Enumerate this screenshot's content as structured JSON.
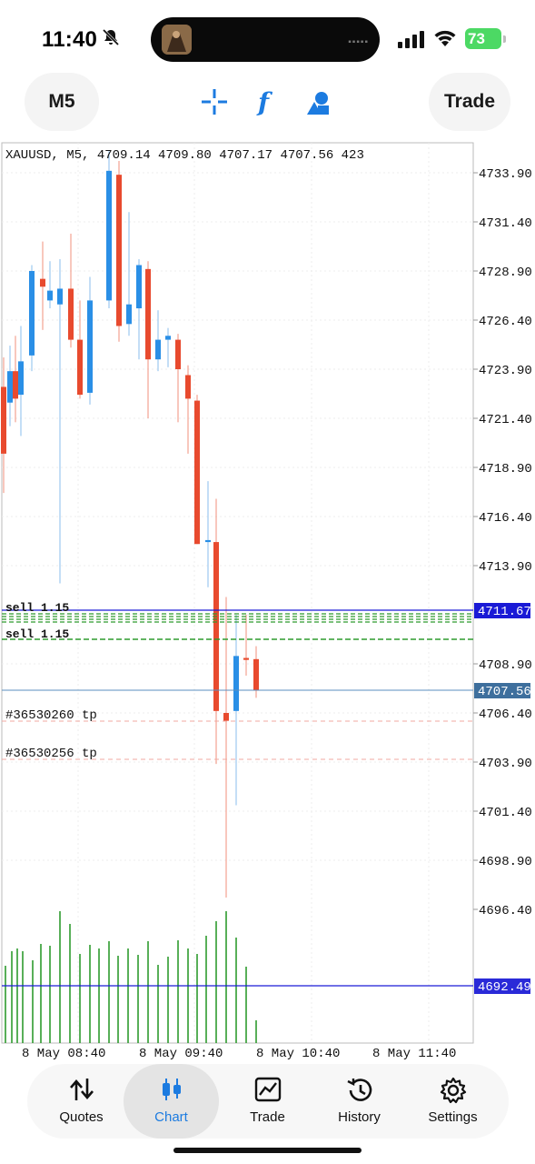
{
  "status": {
    "time": "11:40",
    "battery": "73"
  },
  "toolbar": {
    "timeframe": "M5",
    "trade": "Trade"
  },
  "chart": {
    "info_line": "XAUUSD, M5, 4709.14 4709.80 4707.17 4707.56 423",
    "price_ticks": [
      "4733.90",
      "4731.40",
      "4728.90",
      "4726.40",
      "4723.90",
      "4721.40",
      "4718.90",
      "4716.40",
      "4713.90",
      "4708.90",
      "4706.40",
      "4703.90",
      "4701.40",
      "4698.90",
      "4696.40"
    ],
    "sell_line_value": "4711.67",
    "bid_value": "4707.56",
    "volume_line_value": "4692.49",
    "order_labels": [
      "sell 1.15",
      "sell 1.15"
    ],
    "tp_labels": [
      "#36530260 tp",
      "#36530256 tp"
    ],
    "time_ticks": [
      "8 May 08:40",
      "8 May 09:40",
      "8 May 10:40",
      "8 May 11:40"
    ],
    "colors": {
      "bull": "#2a8fe6",
      "bear": "#e84a2e",
      "volume": "#2e9b2e",
      "sell_line": "#1a1ad6",
      "bid_line": "#5b8fbf",
      "tp_line": "#f0a8a0",
      "grid": "#ededed"
    }
  },
  "tabs": [
    {
      "label": "Quotes",
      "icon": "arrows-updown-icon"
    },
    {
      "label": "Chart",
      "icon": "candles-icon"
    },
    {
      "label": "Trade",
      "icon": "trend-chart-icon"
    },
    {
      "label": "History",
      "icon": "history-clock-icon"
    },
    {
      "label": "Settings",
      "icon": "gear-icon"
    }
  ]
}
